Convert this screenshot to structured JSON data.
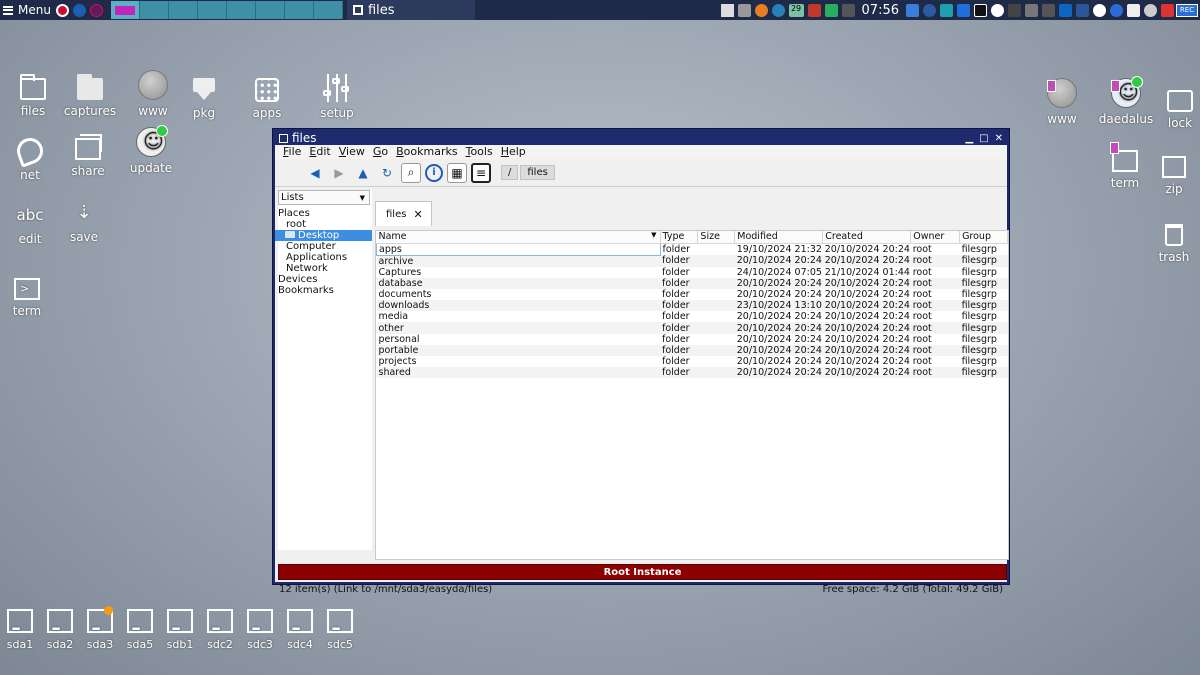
{
  "taskbar": {
    "menu_label": "Menu",
    "active_task": "files",
    "clock": "07:56",
    "calendar_day": "29",
    "rec_label": "REC"
  },
  "desktop_left": [
    {
      "label": "files",
      "icon": "folder-icon"
    },
    {
      "label": "captures",
      "icon": "folder-icon"
    },
    {
      "label": "www",
      "icon": "globe-icon"
    },
    {
      "label": "pkg",
      "icon": "package-icon"
    },
    {
      "label": "apps",
      "icon": "apps-grid-icon"
    },
    {
      "label": "setup",
      "icon": "sliders-icon"
    },
    {
      "label": "net",
      "icon": "network-icon"
    },
    {
      "label": "share",
      "icon": "share-icon"
    },
    {
      "label": "update",
      "icon": "update-icon"
    },
    {
      "label": "edit",
      "icon": "abc-icon"
    },
    {
      "label": "save",
      "icon": "download-icon"
    },
    {
      "label": "term",
      "icon": "terminal-icon"
    }
  ],
  "desktop_right": [
    {
      "label": "www",
      "icon": "globe-icon"
    },
    {
      "label": "daedalus",
      "icon": "daedalus-icon"
    },
    {
      "label": "lock",
      "icon": "lock-icon"
    },
    {
      "label": "term",
      "icon": "terminal-icon"
    },
    {
      "label": "zip",
      "icon": "zip-icon"
    },
    {
      "label": "trash",
      "icon": "trash-icon"
    }
  ],
  "drives": [
    "sda1",
    "sda2",
    "sda3",
    "sda5",
    "sdb1",
    "sdc2",
    "sdc3",
    "sdc4",
    "sdc5"
  ],
  "window": {
    "title": "files",
    "menu": [
      "File",
      "Edit",
      "View",
      "Go",
      "Bookmarks",
      "Tools",
      "Help"
    ],
    "breadcrumb": [
      "/",
      "files"
    ],
    "lists_select": "Lists",
    "places": {
      "header": "Places",
      "root": "root",
      "desktop": "Desktop",
      "computer": "Computer",
      "applications": "Applications",
      "network": "Network",
      "devices": "Devices",
      "bookmarks": "Bookmarks"
    },
    "tab_label": "files",
    "columns": [
      "Name",
      "Type",
      "Size",
      "Modified",
      "Created",
      "Owner",
      "Group"
    ],
    "rows": [
      [
        "apps",
        "folder",
        "",
        "19/10/2024 21:32",
        "20/10/2024 20:24",
        "root",
        "filesgrp"
      ],
      [
        "archive",
        "folder",
        "",
        "20/10/2024 20:24",
        "20/10/2024 20:24",
        "root",
        "filesgrp"
      ],
      [
        "Captures",
        "folder",
        "",
        "24/10/2024 07:05",
        "21/10/2024 01:44",
        "root",
        "filesgrp"
      ],
      [
        "database",
        "folder",
        "",
        "20/10/2024 20:24",
        "20/10/2024 20:24",
        "root",
        "filesgrp"
      ],
      [
        "documents",
        "folder",
        "",
        "20/10/2024 20:24",
        "20/10/2024 20:24",
        "root",
        "filesgrp"
      ],
      [
        "downloads",
        "folder",
        "",
        "23/10/2024 13:10",
        "20/10/2024 20:24",
        "root",
        "filesgrp"
      ],
      [
        "media",
        "folder",
        "",
        "20/10/2024 20:24",
        "20/10/2024 20:24",
        "root",
        "filesgrp"
      ],
      [
        "other",
        "folder",
        "",
        "20/10/2024 20:24",
        "20/10/2024 20:24",
        "root",
        "filesgrp"
      ],
      [
        "personal",
        "folder",
        "",
        "20/10/2024 20:24",
        "20/10/2024 20:24",
        "root",
        "filesgrp"
      ],
      [
        "portable",
        "folder",
        "",
        "20/10/2024 20:24",
        "20/10/2024 20:24",
        "root",
        "filesgrp"
      ],
      [
        "projects",
        "folder",
        "",
        "20/10/2024 20:24",
        "20/10/2024 20:24",
        "root",
        "filesgrp"
      ],
      [
        "shared",
        "folder",
        "",
        "20/10/2024 20:24",
        "20/10/2024 20:24",
        "root",
        "filesgrp"
      ]
    ],
    "root_banner": "Root Instance",
    "status_left": "12 item(s) (Link to /mnt/sda3/easyda/files)",
    "status_right": "Free space: 4.2 GiB (Total: 49.2 GiB)"
  },
  "colors": {
    "panel": "#1e2a47",
    "window_frame": "#1e2a6e",
    "root_banner": "#8b0000",
    "selection": "#3d8ee0"
  }
}
